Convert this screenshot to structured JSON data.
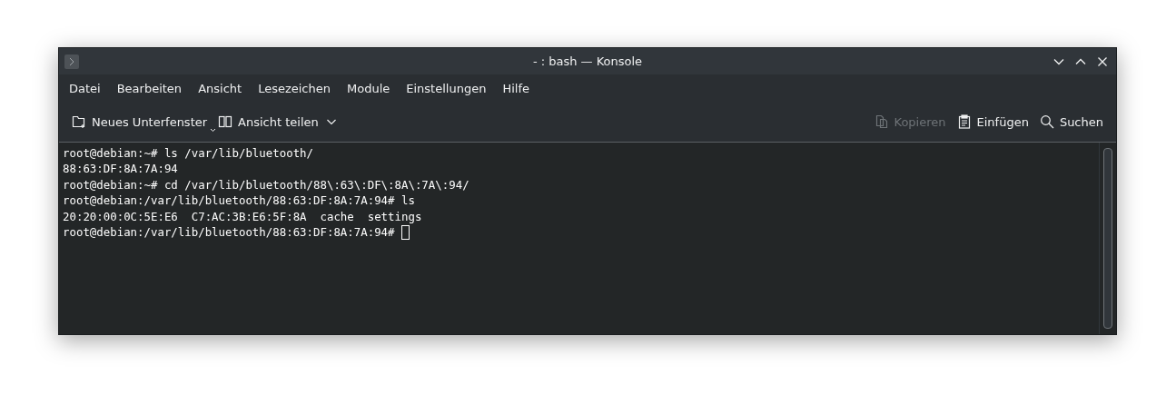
{
  "window": {
    "title": "- : bash — Konsole"
  },
  "menu": [
    "Datei",
    "Bearbeiten",
    "Ansicht",
    "Lesezeichen",
    "Module",
    "Einstellungen",
    "Hilfe"
  ],
  "toolbar_left": [
    {
      "label": "Neues Unterfenster",
      "kind": "new-tab",
      "disabled": false
    },
    {
      "label": "Ansicht teilen",
      "kind": "split",
      "disabled": false
    }
  ],
  "toolbar_right": [
    {
      "label": "Kopieren",
      "kind": "copy",
      "disabled": true
    },
    {
      "label": "Einfügen",
      "kind": "paste",
      "disabled": false
    },
    {
      "label": "Suchen",
      "kind": "search",
      "disabled": false
    }
  ],
  "terminal": {
    "lines": [
      "root@debian:~# ls /var/lib/bluetooth/",
      "88:63:DF:8A:7A:94",
      "root@debian:~# cd /var/lib/bluetooth/88\\:63\\:DF\\:8A\\:7A\\:94/",
      "root@debian:/var/lib/bluetooth/88:63:DF:8A:7A:94# ls",
      "20:20:00:0C:5E:E6  C7:AC:3B:E6:5F:8A  cache  settings",
      "root@debian:/var/lib/bluetooth/88:63:DF:8A:7A:94# "
    ],
    "cursor": true
  }
}
